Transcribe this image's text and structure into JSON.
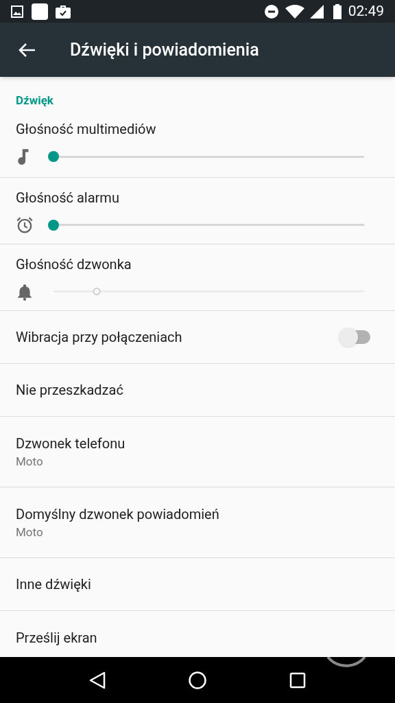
{
  "status_bar": {
    "time": "02:49"
  },
  "app_bar": {
    "title": "Dźwięki i powiadomienia"
  },
  "section": {
    "title": "Dźwięk"
  },
  "items": [
    {
      "kind": "slider",
      "title": "Głośność multimediów",
      "level": 0,
      "disabled": false
    },
    {
      "kind": "slider",
      "title": "Głośność alarmu",
      "level": 0,
      "disabled": false
    },
    {
      "kind": "slider",
      "title": "Głośność dzwonka",
      "level": 0.14,
      "disabled": true
    },
    {
      "kind": "switch",
      "title": "Wibracja przy połączeniach",
      "on": false
    },
    {
      "kind": "plain",
      "title": "Nie przeszkadzać"
    },
    {
      "kind": "plain",
      "title": "Dzwonek telefonu",
      "summary": "Moto"
    },
    {
      "kind": "plain",
      "title": "Domyślny dzwonek powiadomień",
      "summary": "Moto"
    },
    {
      "kind": "plain",
      "title": "Inne dźwięki"
    },
    {
      "kind": "plain",
      "title": "Prześlij ekran"
    }
  ]
}
